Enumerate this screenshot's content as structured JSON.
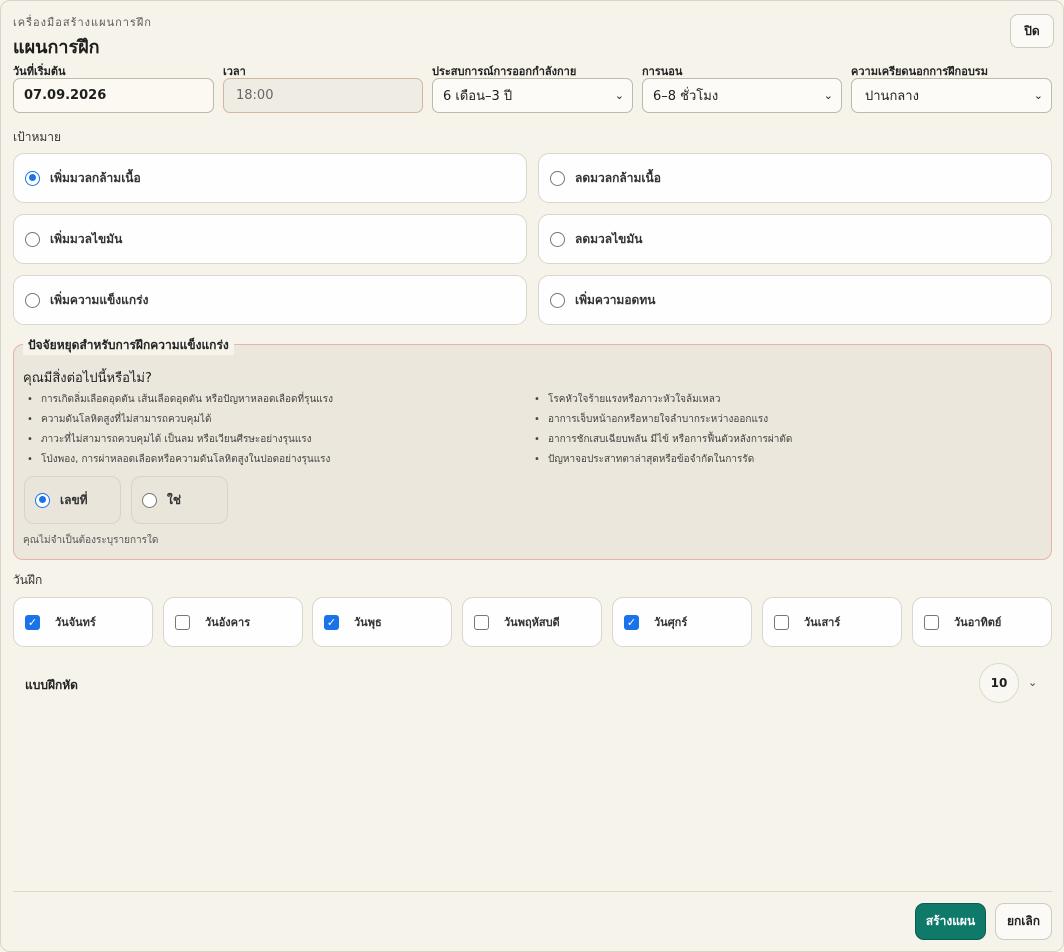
{
  "header": {
    "kicker": "เครื่องมือสร้างแผนการฝึก",
    "title": "แผนการฝึก",
    "close_label": "ปิด"
  },
  "fields": {
    "start_date": {
      "label": "วันที่เริ่มต้น",
      "value": "07.09.2026"
    },
    "time": {
      "label": "เวลา",
      "value": "18:00"
    },
    "experience": {
      "label": "ประสบการณ์การออกกำลังกาย",
      "value": "6 เดือน–3 ปี"
    },
    "sleep": {
      "label": "การนอน",
      "value": "6–8 ชั่วโมง"
    },
    "stress": {
      "label": "ความเครียดนอกการฝึกอบรม",
      "value": "ปานกลาง"
    }
  },
  "goals": {
    "label": "เป้าหมาย",
    "items": [
      {
        "label": "เพิ่มมวลกล้ามเนื้อ",
        "selected": true
      },
      {
        "label": "ลดมวลกล้ามเนื้อ",
        "selected": false
      },
      {
        "label": "เพิ่มมวลไขมัน",
        "selected": false
      },
      {
        "label": "ลดมวลไขมัน",
        "selected": false
      },
      {
        "label": "เพิ่มความแข็งแกร่ง",
        "selected": false
      },
      {
        "label": "เพิ่มความอดทน",
        "selected": false
      }
    ]
  },
  "risk": {
    "legend": "ปัจจัยหยุดสำหรับการฝึกความแข็งแกร่ง",
    "question": "คุณมีสิ่งต่อไปนี้หรือไม่?",
    "left_items": [
      "การเกิดลิ่มเลือดอุดตัน เส้นเลือดอุดตัน หรือปัญหาหลอดเลือดที่รุนแรง",
      "ความดันโลหิตสูงที่ไม่สามารถควบคุมได้",
      "ภาวะที่ไม่สามารถควบคุมได้ เป็นลม หรือเวียนศีรษะอย่างรุนแรง",
      "โป่งพอง, การผ่าหลอดเลือดหรือความดันโลหิตสูงในปอดอย่างรุนแรง"
    ],
    "right_items": [
      "โรคหัวใจร้ายแรงหรือภาวะหัวใจล้มเหลว",
      "อาการเจ็บหน้าอกหรือหายใจลำบากระหว่างออกแรง",
      "อาการชักเสบเฉียบพลัน มีไข้ หรือการฟื้นตัวหลังการผ่าตัด",
      "ปัญหาจอประสาทตาล่าสุดหรือข้อจำกัดในการรัด"
    ],
    "options": [
      {
        "label": "เลขที่",
        "selected": true
      },
      {
        "label": "ใช่",
        "selected": false
      }
    ],
    "hint": "คุณไม่จำเป็นต้องระบุรายการใด"
  },
  "days": {
    "label": "วันฝึก",
    "items": [
      {
        "label": "วันจันทร์",
        "checked": true
      },
      {
        "label": "วันอังคาร",
        "checked": false
      },
      {
        "label": "วันพุธ",
        "checked": true
      },
      {
        "label": "วันพฤหัสบดี",
        "checked": false
      },
      {
        "label": "วันศุกร์",
        "checked": true
      },
      {
        "label": "วันเสาร์",
        "checked": false
      },
      {
        "label": "วันอาทิตย์",
        "checked": false
      }
    ]
  },
  "sets": {
    "label": "แบบฝึกหัด",
    "value": "10"
  },
  "footer": {
    "primary_label": "สร้างแผน",
    "secondary_label": "ยกเลิก"
  },
  "colors": {
    "accent": "#1a73e8",
    "primary_button": "#0f7a69",
    "warning_border": "#e8b3aa",
    "background": "#f6f3ea"
  }
}
